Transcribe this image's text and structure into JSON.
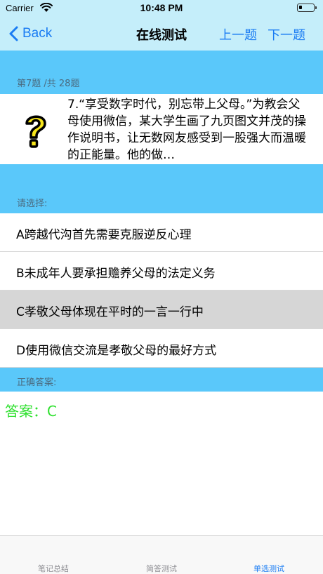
{
  "status_bar": {
    "carrier": "Carrier",
    "time": "10:48 PM"
  },
  "nav": {
    "back_label": "Back",
    "title": "在线测试",
    "prev_label": "上一题",
    "next_label": "下一题"
  },
  "question": {
    "progress": "第7题 /共 28题",
    "text": "7.“享受数字时代，别忘带上父母。”为教会父母使用微信，某大学生画了九页图文并茂的操作说明书，让无数网友感受到一股强大而温暖的正能量。他的做…",
    "icon": "question-mark-icon"
  },
  "choose_label": "请选择:",
  "options": [
    {
      "label": "A跨越代沟首先需要克服逆反心理",
      "selected": false
    },
    {
      "label": "B未成年人要承担赡养父母的法定义务",
      "selected": false
    },
    {
      "label": "C孝敬父母体现在平时的一言一行中",
      "selected": true
    },
    {
      "label": "D使用微信交流是孝敬父母的最好方式",
      "selected": false
    }
  ],
  "answer_section_label": "正确答案:",
  "answer_text": "答案：C",
  "tabbar": {
    "tabs": [
      {
        "label": "笔记总结",
        "active": false
      },
      {
        "label": "简答测试",
        "active": false
      },
      {
        "label": "单选测试",
        "active": true
      }
    ]
  },
  "colors": {
    "accent": "#1a7cf3",
    "header_bg": "#c5eefa",
    "band_bg": "#5ac8fa",
    "answer_green": "#2ee02e",
    "selected_row": "#d6d6d6"
  }
}
